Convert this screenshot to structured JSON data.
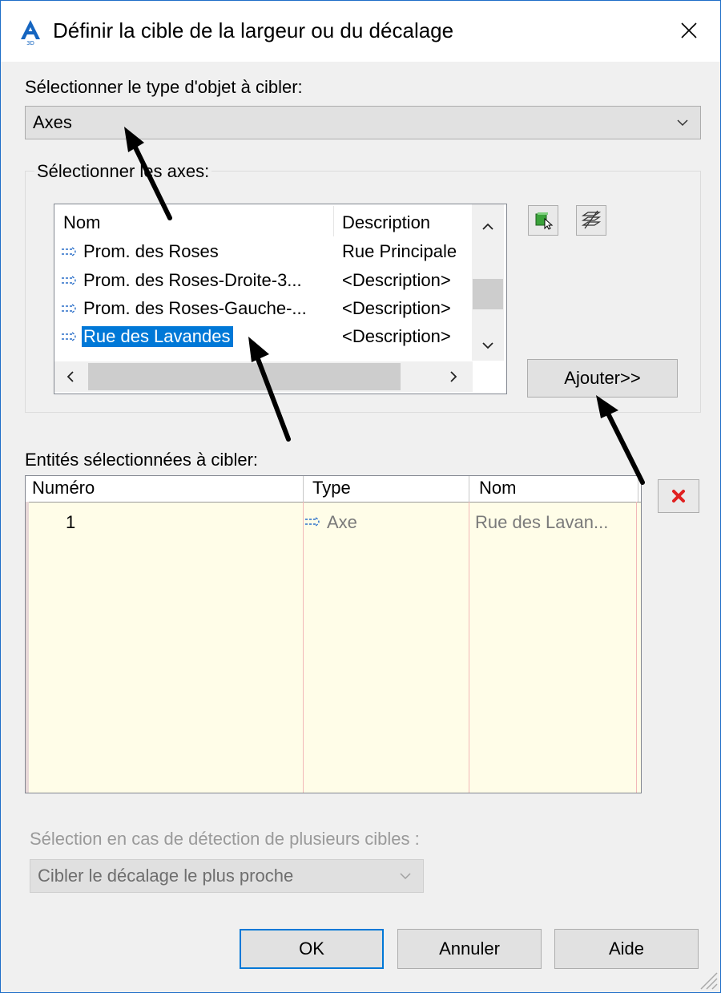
{
  "window": {
    "title": "Définir la cible de la largeur ou du décalage",
    "app_icon": "autocad-civil-icon",
    "close_icon": "close-icon"
  },
  "object_type": {
    "label": "Sélectionner le type d'objet à cibler:",
    "selected": "Axes"
  },
  "alignments": {
    "group_label": "Sélectionner les axes:",
    "columns": [
      "Nom",
      "Description"
    ],
    "rows": [
      {
        "name": "Prom. des Roses",
        "description": "Rue Principale"
      },
      {
        "name": "Prom. des Roses-Droite-3...",
        "description": "<Description>"
      },
      {
        "name": "Prom. des Roses-Gauche-...",
        "description": "<Description>"
      },
      {
        "name": "Rue des Lavandes",
        "description": "<Description>",
        "selected": true
      }
    ],
    "tools": [
      "select-from-drawing-icon",
      "layers-icon"
    ],
    "add_button": "Ajouter>>"
  },
  "selected_entities": {
    "label": "Entités sélectionnées à cibler:",
    "columns": [
      "Numéro",
      "Type",
      "Nom"
    ],
    "rows": [
      {
        "number": "1",
        "type": "Axe",
        "name": "Rue des Lavan..."
      }
    ],
    "delete_icon": "delete-icon"
  },
  "multiple_targets": {
    "label": "Sélection en cas de détection de plusieurs cibles :",
    "selected": "Cibler le décalage le plus proche"
  },
  "buttons": {
    "ok": "OK",
    "cancel": "Annuler",
    "help": "Aide"
  },
  "colors": {
    "accent": "#0078d7",
    "window_border": "#1e6ec8",
    "grid_background": "#fffde8",
    "delete_red": "#e02020"
  }
}
